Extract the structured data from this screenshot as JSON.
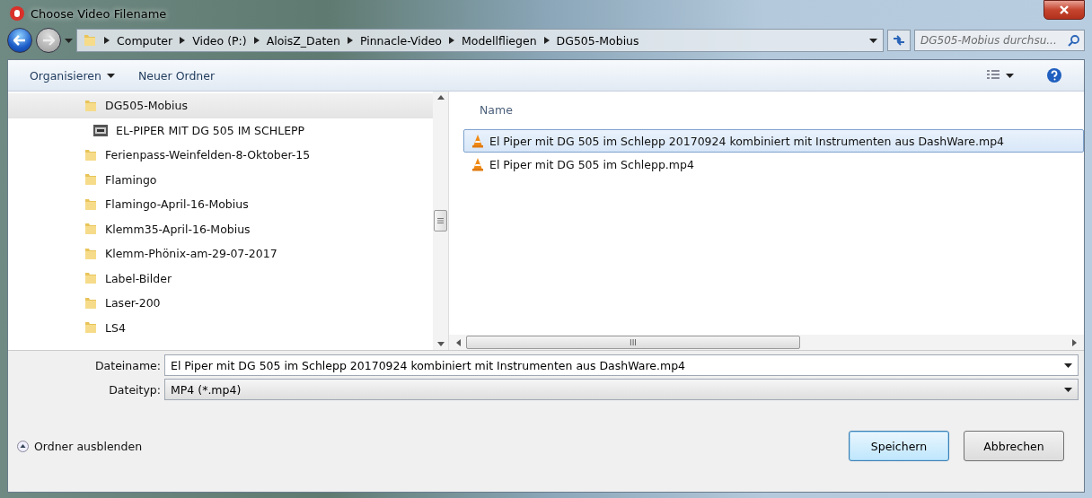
{
  "window": {
    "title": "Choose Video Filename"
  },
  "address_bar": {
    "crumbs": [
      "Computer",
      "Video (P:)",
      "AloisZ_Daten",
      "Pinnacle-Video",
      "Modellfliegen",
      "DG505-Mobius"
    ]
  },
  "search": {
    "placeholder": "DG505-Mobius durchsu..."
  },
  "toolbar": {
    "organize": "Organisieren",
    "new_folder": "Neuer Ordner"
  },
  "tree": [
    {
      "label": "DG505-Mobius",
      "kind": "folder",
      "selected": true,
      "children": [
        {
          "label": "EL-PIPER MIT DG 505 IM SCHLEPP",
          "kind": "video-folder",
          "selected": false
        }
      ]
    },
    {
      "label": "Ferienpass-Weinfelden-8-Oktober-15",
      "kind": "folder",
      "selected": false
    },
    {
      "label": "Flamingo",
      "kind": "folder",
      "selected": false
    },
    {
      "label": "Flamingo-April-16-Mobius",
      "kind": "folder",
      "selected": false
    },
    {
      "label": "Klemm35-April-16-Mobius",
      "kind": "folder",
      "selected": false
    },
    {
      "label": "Klemm-Phönix-am-29-07-2017",
      "kind": "folder",
      "selected": false
    },
    {
      "label": "Label-Bilder",
      "kind": "folder",
      "selected": false
    },
    {
      "label": "Laser-200",
      "kind": "folder",
      "selected": false
    },
    {
      "label": "LS4",
      "kind": "folder",
      "selected": false
    }
  ],
  "file_list": {
    "columns": [
      "Name"
    ],
    "rows": [
      {
        "name": "El Piper mit DG 505 im Schlepp 20170924 kombiniert mit Instrumenten aus DashWare.mp4",
        "selected": true
      },
      {
        "name": "El Piper mit DG 505 im Schlepp.mp4",
        "selected": false
      }
    ],
    "scroll_mark": "III"
  },
  "filename": {
    "label": "Dateiname:",
    "value": "El Piper mit DG 505 im Schlepp 20170924 kombiniert mit Instrumenten aus DashWare.mp4"
  },
  "filetype": {
    "label": "Dateityp:",
    "value": "MP4 (*.mp4)"
  },
  "hide_folders": "Ordner ausblenden",
  "buttons": [
    {
      "label": "Speichern",
      "kind": "primary"
    },
    {
      "label": "Abbrechen",
      "kind": "normal"
    }
  ]
}
